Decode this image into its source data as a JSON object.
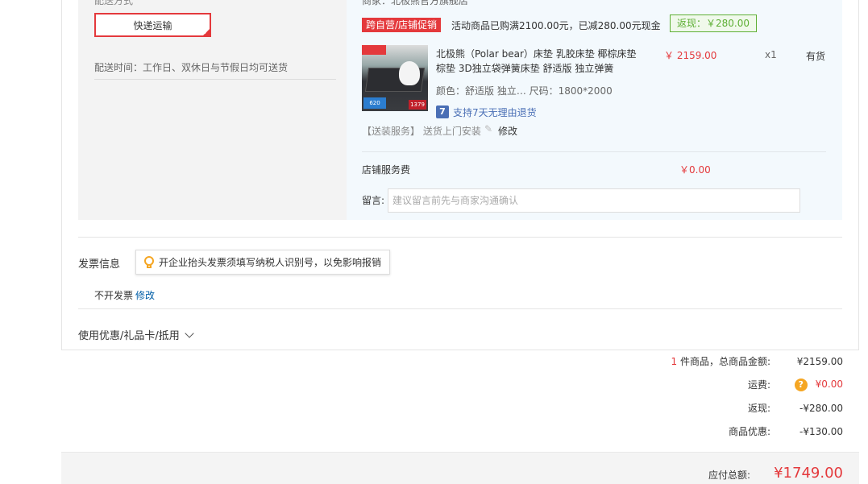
{
  "header_cut": {
    "left_text": "配送方式",
    "right_text": "商家：北极熊官方旗舰店"
  },
  "shipping": {
    "method_label": "快递运输",
    "delivery_time": "配送时间：工作日、双休日与节假日均可送货"
  },
  "promo": {
    "tag": "跨自营/店铺促销",
    "text": "活动商品已购满2100.00元，已减280.00元现金",
    "rebate": "返现：￥280.00"
  },
  "item": {
    "name": "北极熊（Polar bear）床垫 乳胶床垫 椰棕床垫 棕垫 3D独立袋弹簧床垫 舒适版 独立弹簧",
    "attrs": "颜色：舒适版 独立…   尺码：1800*2000",
    "return_icon": "7",
    "return_text": "支持7天无理由退货",
    "price": "￥ 2159.00",
    "qty": "x1",
    "stock": "有货",
    "thumb_coupon": "620",
    "thumb_price": "1379"
  },
  "install": {
    "label": "【送装服务】 送货上门安装",
    "edit": "修改"
  },
  "store_service": {
    "label": "店铺服务费",
    "price": "￥0.00"
  },
  "message": {
    "label": "留言:",
    "placeholder": "建议留言前先与商家沟通确认"
  },
  "invoice": {
    "title": "发票信息",
    "tip": "开企业抬头发票须填写纳税人识别号，以免影响报销",
    "status": "不开发票",
    "edit": "修改"
  },
  "coupon_toggle": "使用优惠/礼品卡/抵用",
  "summary": {
    "count": "1",
    "count_suffix": " 件商品，总商品金额:",
    "goods_total": "¥2159.00",
    "freight_label": "运费:",
    "freight_icon": "?",
    "freight": "¥0.00",
    "rebate_label": "返现:",
    "rebate": "-¥280.00",
    "discount_label": "商品优惠:",
    "discount": "-¥130.00",
    "total_label": "应付总额:",
    "total": "¥1749.00"
  },
  "colors": {
    "accent_red": "#e4393c",
    "link_blue": "#005ea7",
    "rebate_green": "#5daf34"
  },
  "icons": [
    "check-icon",
    "pencil-icon",
    "bulb-icon",
    "chevron-down-icon",
    "question-icon",
    "return-7day-icon"
  ]
}
